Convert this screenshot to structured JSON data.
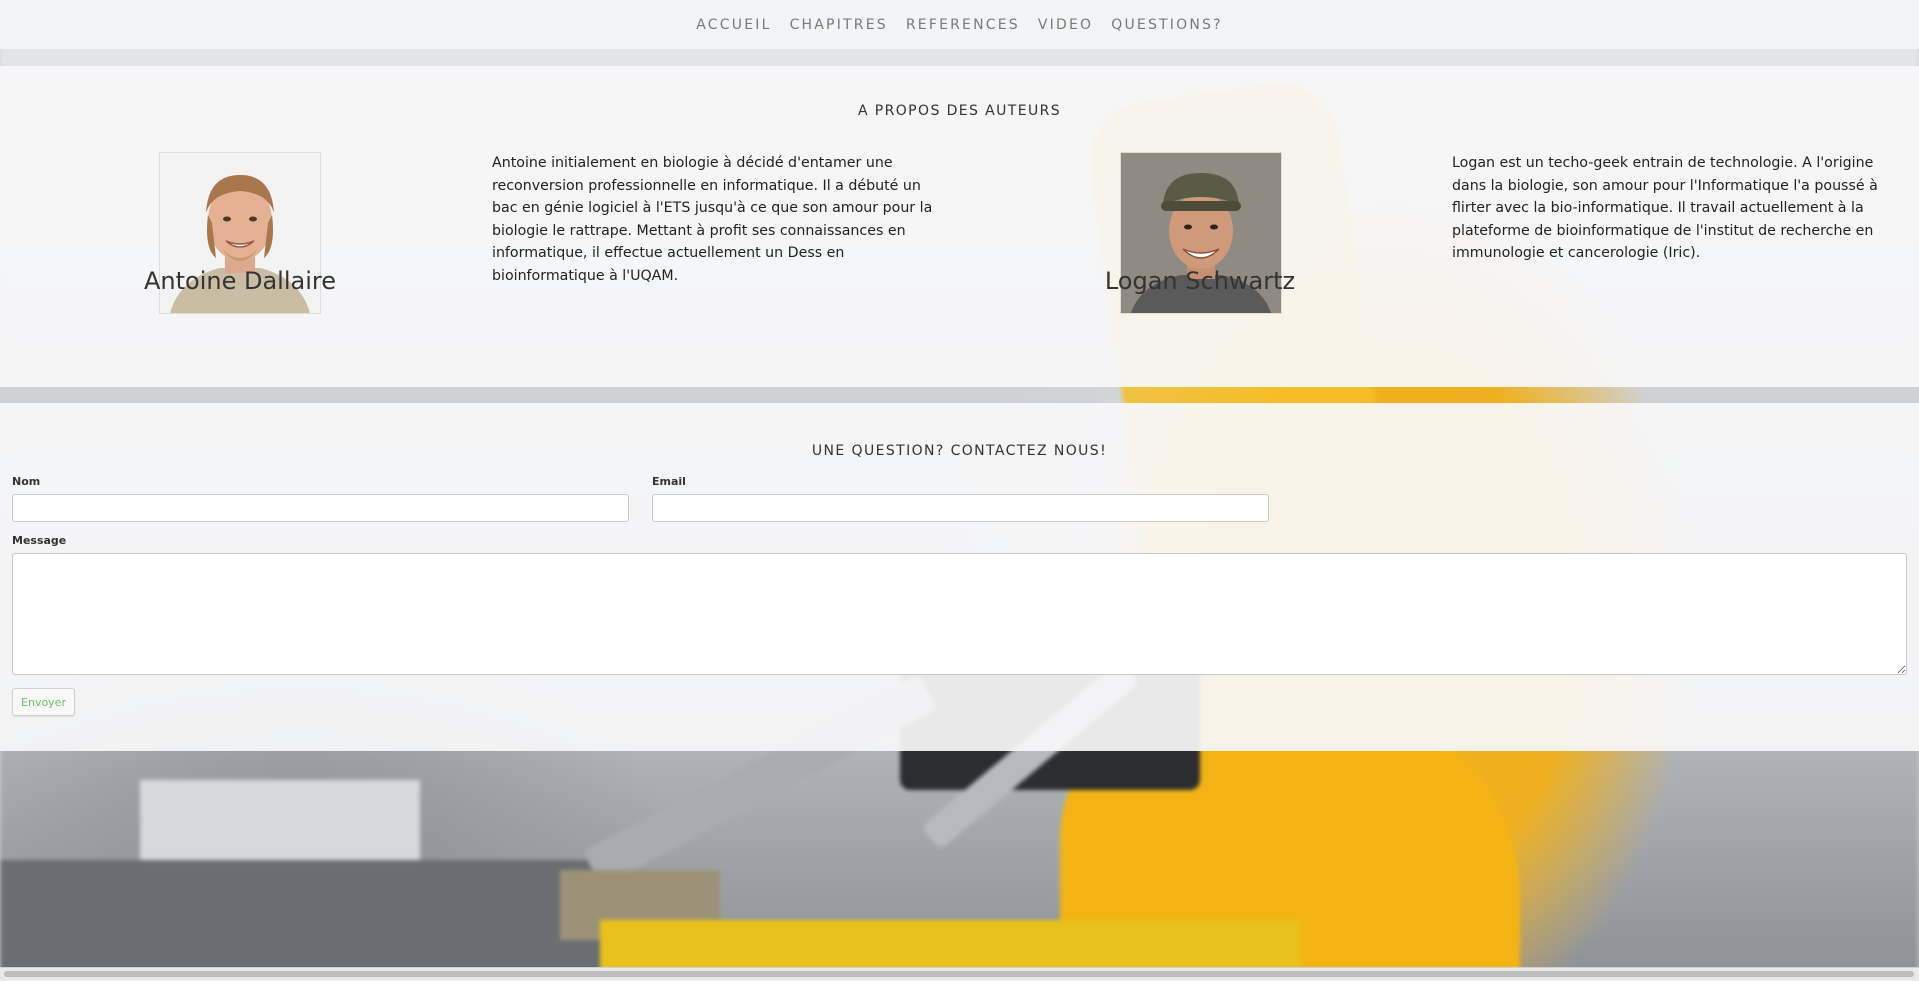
{
  "nav": {
    "items": [
      "ACCUEIL",
      "CHAPITRES",
      "REFERENCES",
      "VIDEO",
      "QUESTIONS?"
    ]
  },
  "about": {
    "title": "A PROPOS DES AUTEURS",
    "authors": [
      {
        "name": "Antoine Dallaire",
        "bio": "Antoine initialement en biologie à décidé d'entamer une reconversion professionnelle en informatique. Il a débuté un bac en génie logiciel à l'ETS jusqu'à ce que son amour pour la biologie le rattrape. Mettant à profit ses connaissances en informatique, il effectue actuellement un Dess en bioinformatique à l'UQAM.",
        "photo": "portrait-icon"
      },
      {
        "name": "Logan Schwartz",
        "bio": "Logan est un techo-geek entrain de technologie. A l'origine dans la biologie, son amour pour l'Informatique l'a poussé à flirter avec la bio-informatique. Il travail actuellement à la plateforme de bioinformatique de l'institut de recherche en immunologie et cancerologie (Iric).",
        "photo": "portrait-icon"
      }
    ]
  },
  "contact": {
    "title": "UNE QUESTION? CONTACTEZ NOUS!",
    "name_label": "Nom",
    "name_value": "",
    "email_label": "Email",
    "email_value": "",
    "message_label": "Message",
    "message_value": "",
    "submit_label": "Envoyer"
  },
  "colors": {
    "nav_text": "#7a7a7a",
    "submit_text": "#6cbf6c",
    "accent_yellow": "#f3b413"
  }
}
